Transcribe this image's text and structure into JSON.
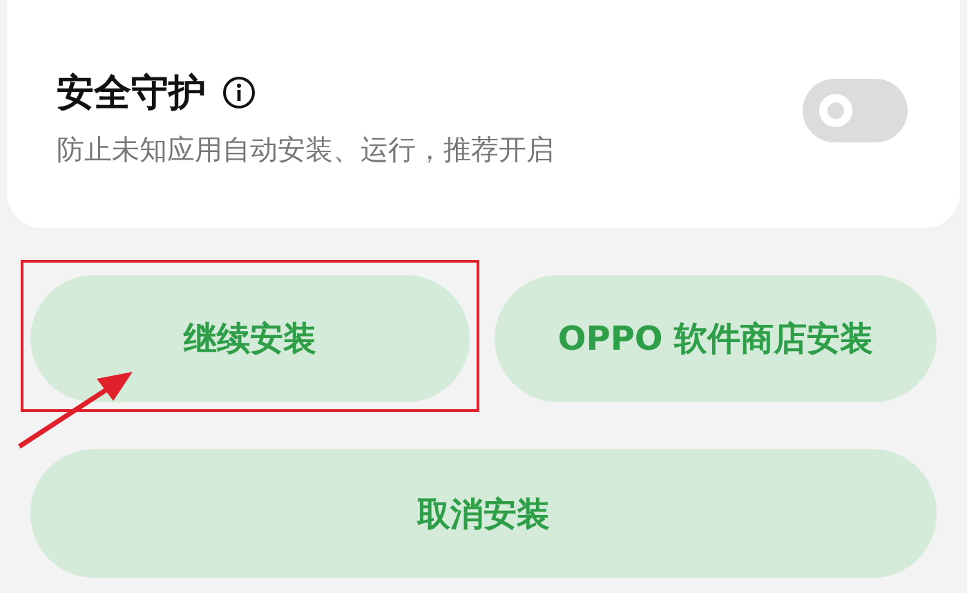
{
  "security_card": {
    "title": "安全守护",
    "description": "防止未知应用自动安装、运行，推荐开启",
    "toggle": {
      "on": false
    }
  },
  "buttons": [
    {
      "label": "继续安装"
    },
    {
      "label": "OPPO 软件商店安装"
    },
    {
      "label": "取消安装"
    }
  ]
}
